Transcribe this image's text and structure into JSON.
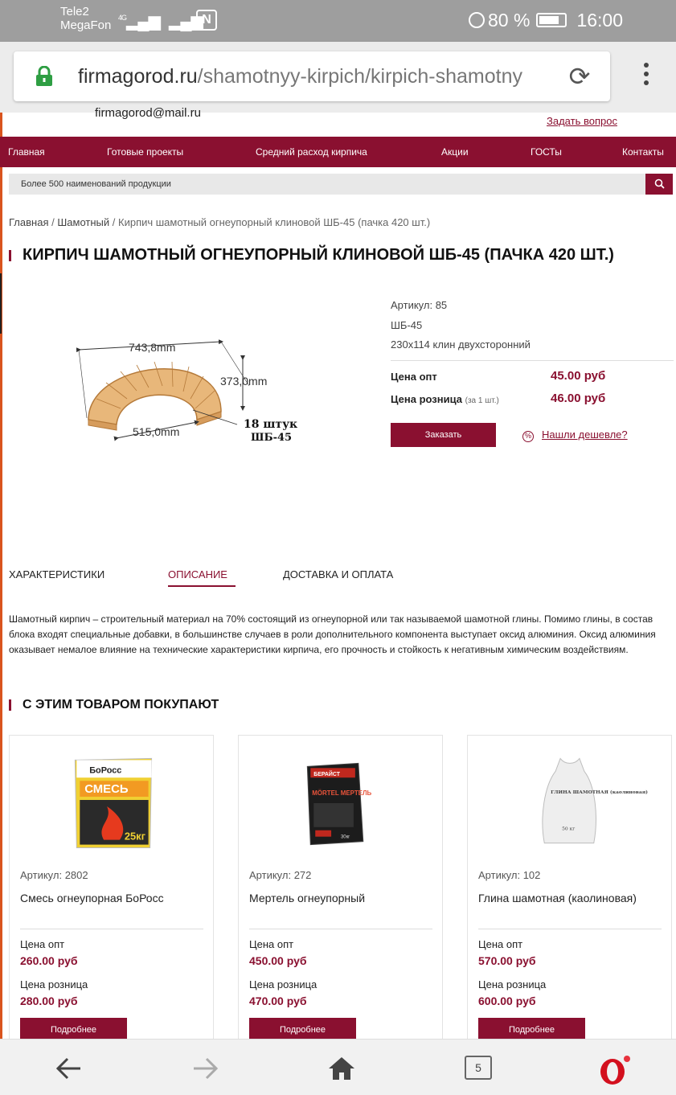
{
  "status_bar": {
    "carrier1": "Tele2",
    "carrier2": "MegaFon",
    "network": "4G",
    "battery_percent": "80 %",
    "time": "16:00"
  },
  "browser": {
    "url_domain": "firmagorod.ru",
    "url_path": "/shamotnyy-kirpich/kirpich-shamotny",
    "open_tabs": "5"
  },
  "header": {
    "email": "firmagorod@mail.ru",
    "ask_link": "Задать вопрос"
  },
  "nav": {
    "items": [
      "Главная",
      "Готовые проекты",
      "Средний расход кирпича",
      "Акции",
      "ГОСТы",
      "Контакты"
    ]
  },
  "search": {
    "placeholder": "Более 500 наименований продукции"
  },
  "breadcrumb": {
    "home": "Главная",
    "category": "Шамотный",
    "current": "Кирпич шамотный огнеупорный клиновой ШБ-45 (пачка 420 шт.)",
    "separator": "/"
  },
  "product": {
    "title": "КИРПИЧ ШАМОТНЫЙ ОГНЕУПОРНЫЙ КЛИНОВОЙ ШБ-45 (ПАЧКА 420 ШТ.)",
    "sku": "Артикул: 85",
    "model": "ШБ-45",
    "short_desc": "230x114 клин двухсторонний",
    "price_opt_label": "Цена опт",
    "price_opt": "45.00 руб",
    "price_retail_label": "Цена розница",
    "price_retail_note": "(за 1 шт.)",
    "price_retail": "46.00 руб",
    "order_button": "Заказать",
    "cheaper_link": "Нашли дешевле?",
    "image": {
      "top_dim": "743,8mm",
      "right_dim": "373,0mm",
      "bottom_dim": "515,0mm",
      "count": "18 штук",
      "code": "ШБ-45"
    }
  },
  "tabs": {
    "characteristics": "ХАРАКТЕРИСТИКИ",
    "description": "ОПИСАНИЕ",
    "delivery": "ДОСТАВКА И ОПЛАТА"
  },
  "description_text": "Шамотный кирпич – строительный материал на 70% состоящий из огнеупорной или так называемой шамотной глины. Помимо глины, в состав блока входят специальные добавки, в большинстве случаев в роли дополнительного компонента выступает оксид алюминия. Оксид алюминия оказывает немалое влияние на технические характеристики кирпича, его прочность и стойкость к негативным химическим воздействиям.",
  "related": {
    "title": "С ЭТИМ ТОВАРОМ ПОКУПАЮТ",
    "items": [
      {
        "sku": "Артикул: 2802",
        "name": "Смесь огнеупорная БоРосс",
        "opt_label": "Цена опт",
        "opt": "260.00 руб",
        "retail_label": "Цена розница",
        "retail": "280.00 руб",
        "button": "Подробнее",
        "brand": "БоРосс",
        "pack_text": "СМЕСЬ",
        "weight": "25кг"
      },
      {
        "sku": "Артикул: 272",
        "name": "Мертель огнеупорный",
        "opt_label": "Цена опт",
        "opt": "450.00 руб",
        "retail_label": "Цена розница",
        "retail": "470.00 руб",
        "button": "Подробнее",
        "brand": "БЕРАЙСТ",
        "pack_text": "MÖRTEL МЕРТЕЛЬ",
        "weight": "30кг"
      },
      {
        "sku": "Артикул: 102",
        "name": "Глина шамотная (каолиновая)",
        "opt_label": "Цена опт",
        "opt": "570.00 руб",
        "retail_label": "Цена розница",
        "retail": "600.00 руб",
        "button": "Подробнее",
        "pack_text": "ГЛИНА ШАМОТНАЯ (каолиновая)",
        "weight": "50 кг"
      }
    ]
  },
  "colors": {
    "brand": "#8a1030",
    "status_bar": "#9e9e9e",
    "lock": "#2e9e43"
  }
}
